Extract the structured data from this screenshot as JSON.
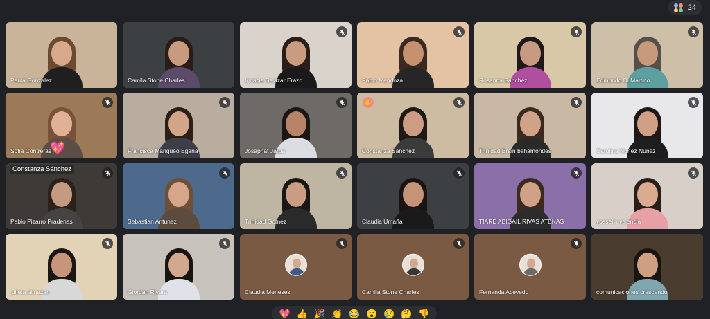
{
  "header": {
    "participant_count": "24"
  },
  "tiles": [
    {
      "name": "Paula Gonzalez",
      "muted": false,
      "bg": "#c9b49a",
      "skin": "#d8a98a",
      "hair": "#6b4a33",
      "shirt": "#1f1f1f"
    },
    {
      "name": "Camila Stone Charles",
      "muted": false,
      "bg": "#3c4043",
      "skin": "#c89a80",
      "hair": "#2a1d17",
      "shirt": "#5b4a6a"
    },
    {
      "name": "Ignacia Salazar Erazo",
      "muted": true,
      "bg": "#d9d3cc",
      "skin": "#c99b80",
      "hair": "#2b1e18",
      "shirt": "#1a1a1a"
    },
    {
      "name": "Pablo Mendoza",
      "muted": true,
      "bg": "#e4c3a5",
      "skin": "#c6916f",
      "hair": "#3a2a22",
      "shirt": "#262626"
    },
    {
      "name": "Rosanna Sánchez",
      "muted": true,
      "bg": "#d8c8a8",
      "skin": "#c79b82",
      "hair": "#1f1a17",
      "shirt": "#b04fa0"
    },
    {
      "name": "Edmundo Di Martino",
      "muted": true,
      "bg": "#cdbfa8",
      "skin": "#c9997c",
      "hair": "#555049",
      "shirt": "#5e9fa0"
    },
    {
      "name": "Sofia Contreras",
      "muted": true,
      "bg": "#9c7a58",
      "skin": "#e0b195",
      "hair": "#7a5238",
      "shirt": "#5a4e46",
      "heart": true
    },
    {
      "name": "Francisca Mariqueo Egaña",
      "muted": true,
      "bg": "#b8ad9e",
      "skin": "#d2a488",
      "hair": "#2b1f18",
      "shirt": "#3c3f48"
    },
    {
      "name": "Josaphat Jarpa",
      "muted": true,
      "bg": "#6e6a66",
      "skin": "#b88468",
      "hair": "#1c1714",
      "shirt": "#dcdce3"
    },
    {
      "name": "Constanza Sánchez",
      "muted": true,
      "bg": "#cdbca2",
      "skin": "#cc9d82",
      "hair": "#1f1915",
      "shirt": "#3b3b3b",
      "reaction": true
    },
    {
      "name": "Trinidad Brain bahamondes",
      "muted": true,
      "bg": "#c9b9a4",
      "skin": "#d0a388",
      "hair": "#3a2a1f",
      "shirt": "#2a2a2a"
    },
    {
      "name": "Carolina Nunez Nunez",
      "muted": true,
      "bg": "#e8e8ea",
      "skin": "#d0a086",
      "hair": "#1f1815",
      "shirt": "#1e1e1e"
    },
    {
      "name": "Pablo Pizarro Pradenas",
      "muted": true,
      "bg": "#3d3a37",
      "skin": "#c69a80",
      "hair": "#2d221a",
      "shirt": "#464442",
      "speaker": "Constanza Sánchez"
    },
    {
      "name": "Sebastian Antunez",
      "muted": true,
      "bg": "#4d6a8c",
      "skin": "#d5a68c",
      "hair": "#6e5038",
      "shirt": "#5c4c3e"
    },
    {
      "name": "Trinidad Gómez",
      "muted": true,
      "bg": "#bfb5a3",
      "skin": "#c99d84",
      "hair": "#1b1714",
      "shirt": "#2a2a2a"
    },
    {
      "name": "Claudia Umaña",
      "muted": true,
      "bg": "#3c4043",
      "skin": "#c49378",
      "hair": "#1a1512",
      "shirt": "#1a1a1a"
    },
    {
      "name": "TIARE ABIGAIL RIVAS ATENAS",
      "muted": true,
      "bg": "#8a6fa8",
      "skin": "#d0a186",
      "hair": "#3a2a22",
      "shirt": "#2c2c2c"
    },
    {
      "name": "yosselin valencia",
      "muted": true,
      "bg": "#d8d0c8",
      "skin": "#d9ab90",
      "hair": "#2a1f18",
      "shirt": "#e6a0a6"
    },
    {
      "name": "julieta almazán",
      "muted": true,
      "bg": "#e2d2b6",
      "skin": "#c7967a",
      "hair": "#1d1713",
      "shirt": "#d8d8d8"
    },
    {
      "name": "Giordan Rivera",
      "muted": true,
      "bg": "#c7c2bb",
      "skin": "#d2a88e",
      "hair": "#1a1411",
      "shirt": "#dfe2e8"
    },
    {
      "name": "Claudia Meneses",
      "muted": true,
      "bg": "#7b5a43",
      "avatar": true,
      "skin": "#d2a88e",
      "hair": "#3b2b21",
      "shirt": "#3e5a88"
    },
    {
      "name": "Camila Stone Charles",
      "muted": true,
      "bg": "#7b5a43",
      "avatar": true,
      "skin": "#d2a88e",
      "hair": "#1f1814",
      "shirt": "#383838"
    },
    {
      "name": "Fernanda Acevedo",
      "muted": true,
      "bg": "#7b5a43",
      "avatar": true,
      "skin": "#d2a88e",
      "hair": "#2a2a2a",
      "shirt": "#6a6a6a"
    },
    {
      "name": "comunicaciones crescendo",
      "muted": false,
      "bg": "#4a3c2e",
      "skin": "#cf9f84",
      "hair": "#1a1512",
      "shirt": "#7fa7b0",
      "selected": true
    }
  ],
  "reactions": [
    "💖",
    "👍",
    "🎉",
    "👏",
    "😂",
    "😮",
    "😢",
    "🤔",
    "👎"
  ]
}
